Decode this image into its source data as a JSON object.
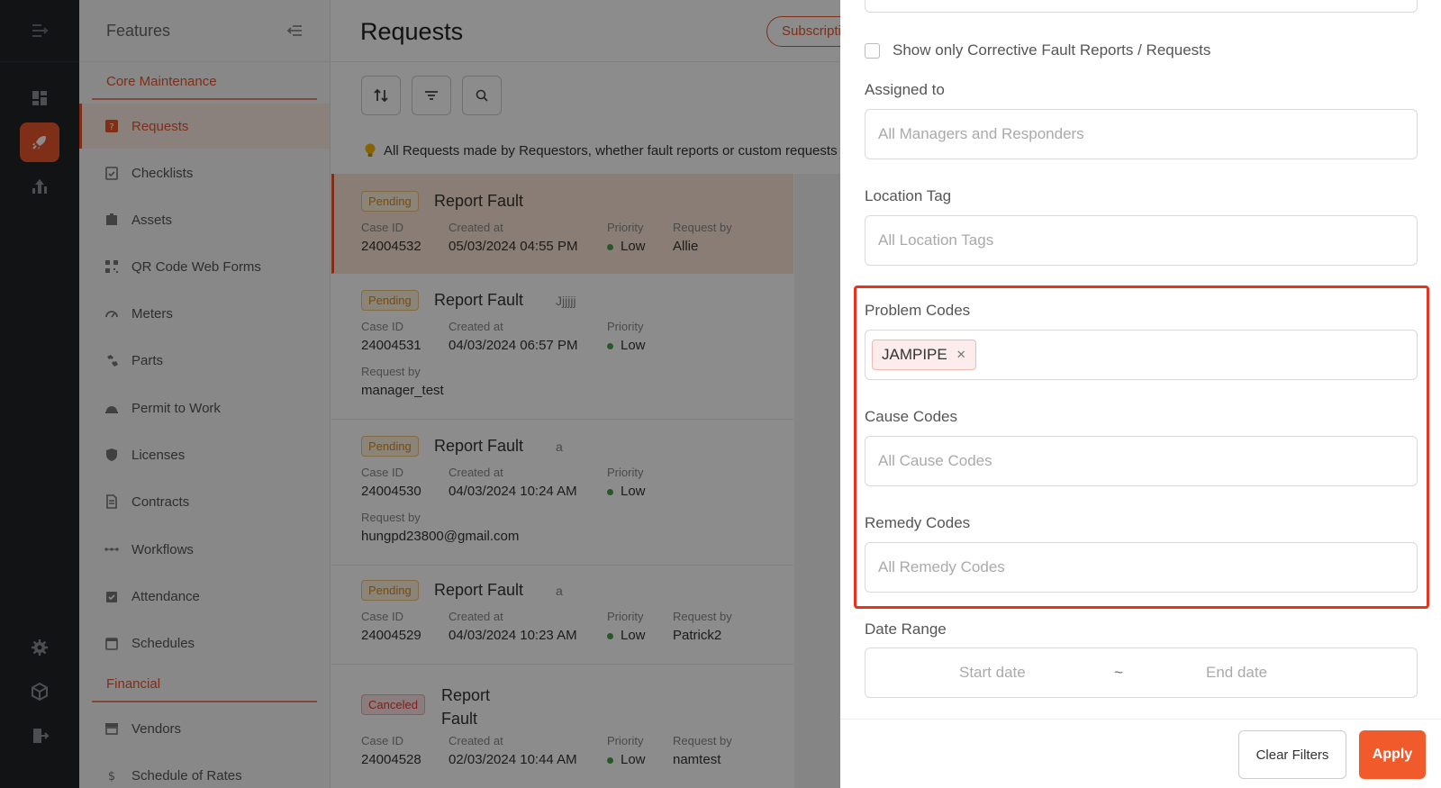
{
  "features": {
    "title": "Features",
    "sections": [
      {
        "title": "Core Maintenance"
      },
      {
        "title": "Financial"
      }
    ],
    "items": [
      {
        "label": "Requests",
        "icon": "request-icon",
        "active": true
      },
      {
        "label": "Checklists",
        "icon": "checklist-icon"
      },
      {
        "label": "Assets",
        "icon": "assets-icon"
      },
      {
        "label": "QR Code Web Forms",
        "icon": "qr-code-icon"
      },
      {
        "label": "Meters",
        "icon": "meter-icon"
      },
      {
        "label": "Parts",
        "icon": "parts-icon"
      },
      {
        "label": "Permit to Work",
        "icon": "permit-icon"
      },
      {
        "label": "Licenses",
        "icon": "shield-icon"
      },
      {
        "label": "Contracts",
        "icon": "contract-icon"
      },
      {
        "label": "Workflows",
        "icon": "workflow-icon"
      },
      {
        "label": "Attendance",
        "icon": "attendance-icon"
      },
      {
        "label": "Schedules",
        "icon": "calendar-icon"
      },
      {
        "label": "Vendors",
        "icon": "vendor-icon"
      },
      {
        "label": "Schedule of Rates",
        "icon": "rates-icon"
      }
    ]
  },
  "main": {
    "title": "Requests",
    "subscribe_label": "Subscriptions",
    "info_banner": "All Requests made by Requestors, whether fault reports or custom requests",
    "labels": {
      "case_id": "Case ID",
      "created_at": "Created at",
      "priority": "Priority",
      "request_by": "Request by"
    },
    "requests": [
      {
        "status": "Pending",
        "title": "Report Fault",
        "extra": "",
        "case_id": "24004532",
        "created_at": "05/03/2024 04:55 PM",
        "priority": "Low",
        "request_by": "Allie"
      },
      {
        "status": "Pending",
        "title": "Report Fault",
        "extra": "Jjjjjj",
        "case_id": "24004531",
        "created_at": "04/03/2024 06:57 PM",
        "priority": "Low",
        "request_by": "manager_test"
      },
      {
        "status": "Pending",
        "title": "Report Fault",
        "extra": "a",
        "case_id": "24004530",
        "created_at": "04/03/2024 10:24 AM",
        "priority": "Low",
        "request_by": "hungpd23800@gmail.com"
      },
      {
        "status": "Pending",
        "title": "Report Fault",
        "extra": "a",
        "case_id": "24004529",
        "created_at": "04/03/2024 10:23 AM",
        "priority": "Low",
        "request_by": "Patrick2"
      },
      {
        "status": "Canceled",
        "title": "Report Fault",
        "extra": "",
        "case_id": "24004528",
        "created_at": "02/03/2024 10:44 AM",
        "priority": "Low",
        "request_by": "namtest"
      }
    ]
  },
  "filters": {
    "corrective_only_label": "Show only Corrective Fault Reports / Requests",
    "assigned_to": {
      "label": "Assigned to",
      "placeholder": "All Managers and Responders"
    },
    "location_tag": {
      "label": "Location Tag",
      "placeholder": "All Location Tags"
    },
    "problem_codes": {
      "label": "Problem Codes",
      "selected": [
        "JAMPIPE"
      ]
    },
    "cause_codes": {
      "label": "Cause Codes",
      "placeholder": "All Cause Codes"
    },
    "remedy_codes": {
      "label": "Remedy Codes",
      "placeholder": "All Remedy Codes"
    },
    "date_range": {
      "label": "Date Range",
      "start_placeholder": "Start date",
      "separator": "~",
      "end_placeholder": "End date"
    },
    "clear_label": "Clear Filters",
    "apply_label": "Apply"
  },
  "colors": {
    "accent": "#e8552d",
    "rail": "#1f2327",
    "highlight": "#e8331f"
  }
}
